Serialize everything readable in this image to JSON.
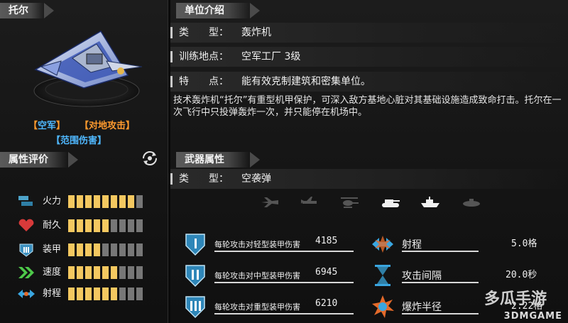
{
  "unit": {
    "name": "托尔",
    "tags": [
      "【空军】",
      "【对地攻击】",
      "【范围伤害】"
    ]
  },
  "left_section": {
    "title": "属性评价",
    "stats": [
      {
        "label": "火力",
        "icon": "firepower-icon",
        "level": 8,
        "max": 9
      },
      {
        "label": "耐久",
        "icon": "heart-icon",
        "level": 5,
        "max": 9
      },
      {
        "label": "装甲",
        "icon": "armor-icon",
        "level": 4,
        "max": 9
      },
      {
        "label": "速度",
        "icon": "speed-chevrons-icon",
        "level": 6,
        "max": 9
      },
      {
        "label": "射程",
        "icon": "range-arrows-icon",
        "level": 6,
        "max": 9
      }
    ]
  },
  "intro": {
    "title": "单位介绍",
    "rows": [
      {
        "label": "类　　型：",
        "value": "轰炸机"
      },
      {
        "label": "训练地点：",
        "value": "空军工厂 3级"
      },
      {
        "label": "特　　点：",
        "value": "能有效克制建筑和密集单位。"
      }
    ],
    "description": "技术轰炸机“托尔”有重型机甲保护，可深入敌方基地心脏对其基础设施造成致命打击。托尔在一次飞行中只投弹轰炸一次，并只能停在机场中。"
  },
  "weapon": {
    "title": "武器属性",
    "type_label": "类　　型：",
    "type_value": "空袭弹",
    "targets": [
      "fighter-plane-icon",
      "transport-plane-icon",
      "helicopter-icon",
      "tank-icon",
      "ship-icon",
      "submarine-icon"
    ],
    "damage": [
      {
        "label": "每轮攻击对轻型装甲伤害",
        "value": "4185",
        "icon": "armor-light-icon"
      },
      {
        "label": "每轮攻击对中型装甲伤害",
        "value": "6945",
        "icon": "armor-medium-icon"
      },
      {
        "label": "每轮攻击对重型装甲伤害",
        "value": "6210",
        "icon": "armor-heavy-icon"
      }
    ],
    "specs": [
      {
        "label": "射程",
        "value": "5.0格",
        "icon": "range-icon"
      },
      {
        "label": "攻击间隔",
        "value": "20.0秒",
        "icon": "hourglass-icon"
      },
      {
        "label": "爆炸半径",
        "value": "2.22格",
        "icon": "explosion-icon"
      }
    ]
  },
  "watermark": {
    "big": "多瓜手游",
    "small": "3DMGAME"
  },
  "colors": {
    "bar_on": "#f4c860",
    "bar_off": "#777777",
    "tag_blue": "#4fb8ff",
    "tag_orange": "#ff9a2e"
  }
}
